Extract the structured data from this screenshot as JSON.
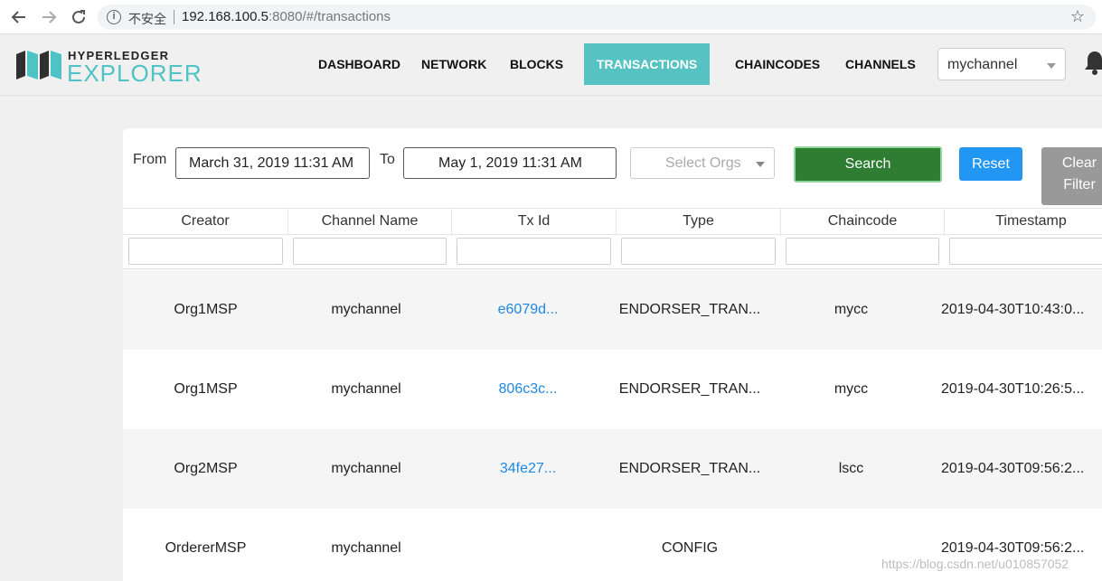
{
  "browser": {
    "insecure_label": "不安全",
    "url_host": "192.168.100.5",
    "url_rest": ":8080/#/transactions"
  },
  "logo": {
    "top": "HYPERLEDGER",
    "bottom": "EXPLORER"
  },
  "nav": {
    "items": [
      {
        "label": "DASHBOARD"
      },
      {
        "label": "NETWORK"
      },
      {
        "label": "BLOCKS"
      },
      {
        "label": "TRANSACTIONS"
      },
      {
        "label": "CHAINCODES"
      },
      {
        "label": "CHANNELS"
      }
    ],
    "active": "TRANSACTIONS",
    "channel": "mychannel"
  },
  "filters": {
    "from_label": "From",
    "from_value": "March 31, 2019 11:31 AM",
    "to_label": "To",
    "to_value": "May 1, 2019 11:31 AM",
    "orgs_placeholder": "Select Orgs",
    "search_label": "Search",
    "reset_label": "Reset",
    "clear_label_1": "Clear",
    "clear_label_2": "Filter"
  },
  "table": {
    "columns": [
      "Creator",
      "Channel Name",
      "Tx Id",
      "Type",
      "Chaincode",
      "Timestamp"
    ],
    "rows": [
      {
        "creator": "Org1MSP",
        "channel": "mychannel",
        "txid": "e6079d...",
        "type": "ENDORSER_TRAN...",
        "chaincode": "mycc",
        "timestamp": "2019-04-30T10:43:0..."
      },
      {
        "creator": "Org1MSP",
        "channel": "mychannel",
        "txid": "806c3c...",
        "type": "ENDORSER_TRAN...",
        "chaincode": "mycc",
        "timestamp": "2019-04-30T10:26:5..."
      },
      {
        "creator": "Org2MSP",
        "channel": "mychannel",
        "txid": "34fe27...",
        "type": "ENDORSER_TRAN...",
        "chaincode": "lscc",
        "timestamp": "2019-04-30T09:56:2..."
      },
      {
        "creator": "OrdererMSP",
        "channel": "mychannel",
        "txid": "",
        "type": "CONFIG",
        "chaincode": "",
        "timestamp": "2019-04-30T09:56:2..."
      }
    ]
  },
  "watermark": "https://blog.csdn.net/u010857052",
  "colors": {
    "accent": "#56c3c2",
    "search": "#2e7d32",
    "reset": "#2196f3",
    "clear": "#999999",
    "link": "#1e88e5"
  }
}
